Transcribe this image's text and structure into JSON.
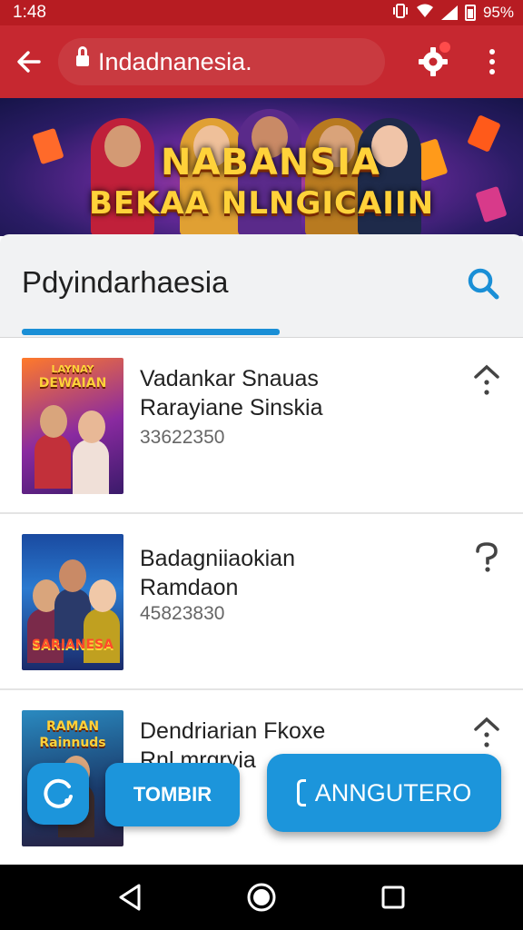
{
  "status_bar": {
    "time": "1:48",
    "battery_text": "95%",
    "icons": [
      "vibrate-icon",
      "wifi-icon",
      "signal-icon",
      "battery-icon"
    ]
  },
  "app_bar": {
    "back_icon": "arrow-left-icon",
    "url": "Indadnanesia.",
    "lock_icon": "lock-icon",
    "extension_icon": "gear-extension-icon",
    "menu_icon": "more-vertical-icon"
  },
  "banner": {
    "title_line1": "NABANSIA",
    "title_line2": "BEKAA NLNGICAIIN"
  },
  "search": {
    "query": "Pdyindarhaesia",
    "search_icon": "search-icon"
  },
  "list": [
    {
      "title_line1": "Vadankar Snauas",
      "title_line2": "Rarayiane Sinskia",
      "number": "33622350",
      "thumb_text_top": "LAYNAY",
      "thumb_text_sub": "DEWAIAN",
      "action_icon": "info-up-icon"
    },
    {
      "title_line1": "Badagniiaokian",
      "title_line2": "Ramdaon",
      "number": "45823830",
      "thumb_text_top": "",
      "thumb_text_sub": "SARIANESA",
      "action_icon": "question-icon"
    },
    {
      "title_line1": "Dendriarian Fkoxe",
      "title_line2": "Rnl mrgryia",
      "number": "",
      "thumb_text_top": "RAMAN",
      "thumb_text_sub": "Rainnuds",
      "action_icon": "info-up-icon"
    }
  ],
  "actions": {
    "refresh_icon": "refresh-icon",
    "secondary_label": "TOMBIR",
    "primary_label": "ANNGUTERO"
  },
  "nav": {
    "back_icon": "nav-back-icon",
    "home_icon": "nav-home-icon",
    "recents_icon": "nav-recents-icon"
  },
  "colors": {
    "app_bar": "#c62830",
    "status_bar": "#b71c22",
    "accent": "#1c95db",
    "banner_title": "#ffd23a"
  }
}
